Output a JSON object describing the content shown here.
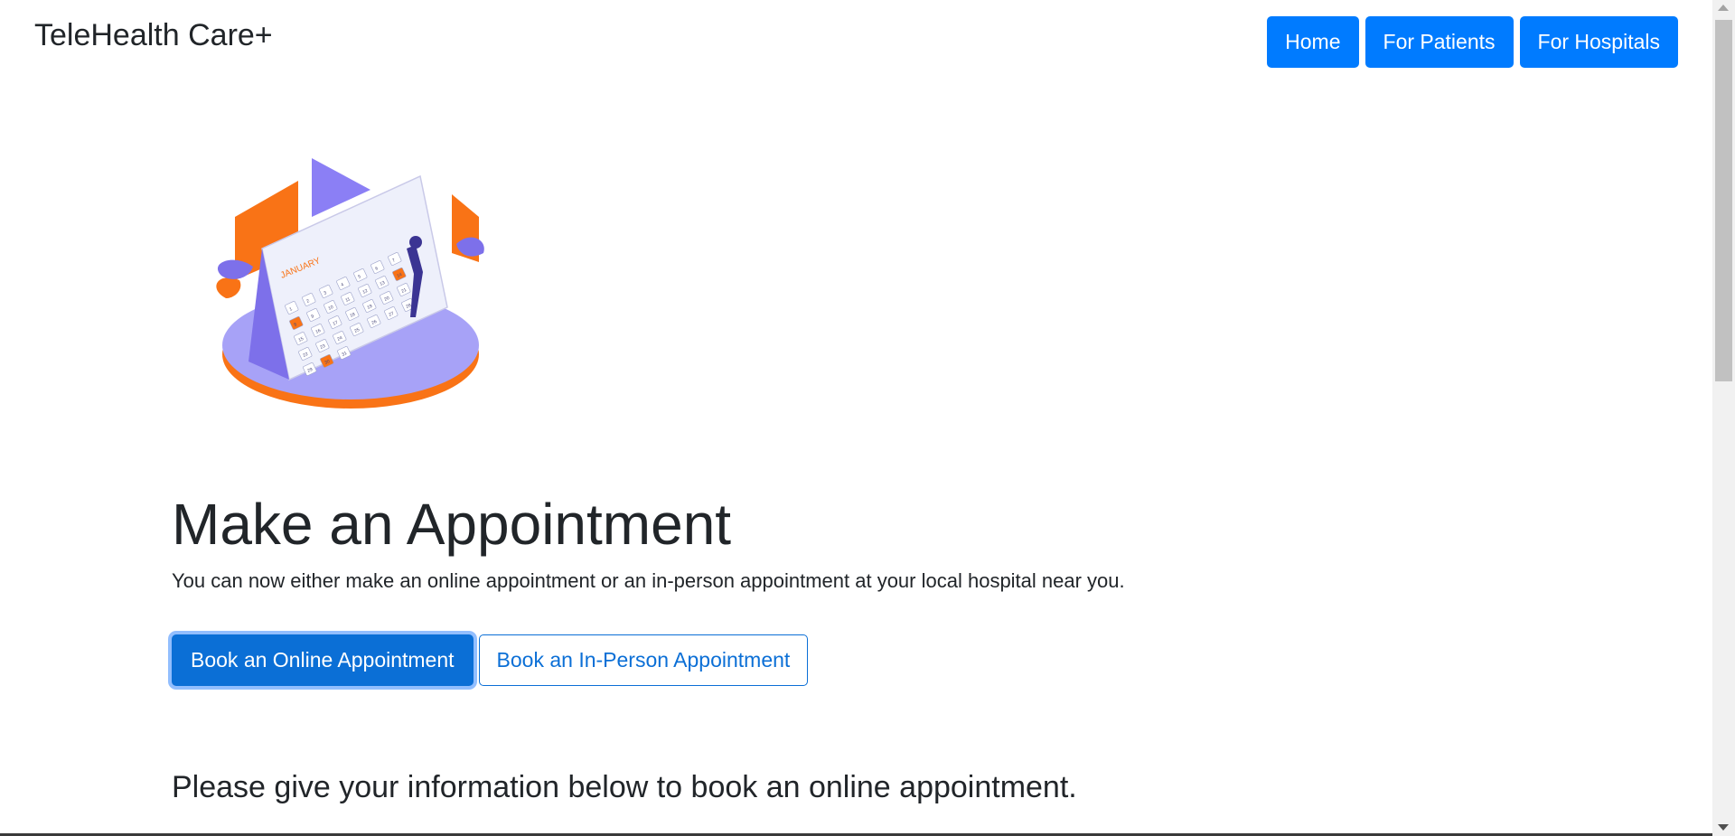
{
  "navbar": {
    "brand": "TeleHealth Care+",
    "links": [
      {
        "label": "Home"
      },
      {
        "label": "For Patients"
      },
      {
        "label": "For Hospitals"
      }
    ]
  },
  "hero": {
    "image_text": "JANUARY",
    "calendar_numbers": [
      "1",
      "2",
      "3",
      "4",
      "5",
      "6",
      "7",
      "8",
      "9",
      "10",
      "11",
      "12",
      "13",
      "14",
      "15",
      "16",
      "17",
      "18",
      "19",
      "20",
      "21",
      "22",
      "23",
      "24",
      "25",
      "26",
      "27",
      "28",
      "29",
      "30",
      "31"
    ]
  },
  "main": {
    "title": "Make an Appointment",
    "subtitle": "You can now either make an online appointment or an in-person appointment at your local hospital near you.",
    "buttons": {
      "online": "Book an Online Appointment",
      "in_person": "Book an In-Person Appointment"
    },
    "form_heading": "Please give your information below to book an online appointment."
  },
  "colors": {
    "primary": "#007bff",
    "active_button": "#0b6fd6",
    "illustration_orange": "#f97316",
    "illustration_purple": "#8b7ff5"
  }
}
